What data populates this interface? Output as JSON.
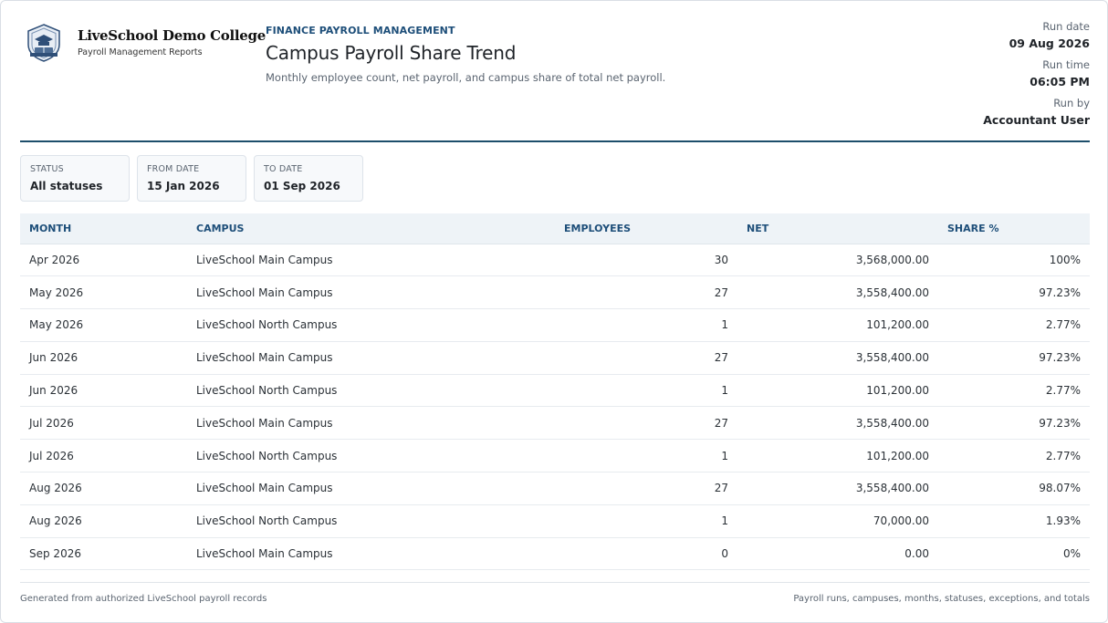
{
  "brand": {
    "name": "LiveSchool Demo College",
    "subtitle": "Payroll Management Reports",
    "logo_icon": "college-crest-icon"
  },
  "report": {
    "eyebrow": "FINANCE PAYROLL MANAGEMENT",
    "title": "Campus Payroll Share Trend",
    "subtitle": "Monthly employee count, net payroll, and campus share of total net payroll."
  },
  "meta": [
    {
      "label": "Run date",
      "value": "09 Aug 2026"
    },
    {
      "label": "Run time",
      "value": "06:05 PM"
    },
    {
      "label": "Run by",
      "value": "Accountant User"
    }
  ],
  "filters": [
    {
      "label": "STATUS",
      "value": "All statuses"
    },
    {
      "label": "FROM DATE",
      "value": "15 Jan 2026"
    },
    {
      "label": "TO DATE",
      "value": "01 Sep 2026"
    }
  ],
  "table": {
    "columns": [
      "MONTH",
      "CAMPUS",
      "EMPLOYEES",
      "NET",
      "SHARE %"
    ],
    "rows": [
      [
        "Apr 2026",
        "LiveSchool Main Campus",
        "30",
        "3,568,000.00",
        "100%"
      ],
      [
        "May 2026",
        "LiveSchool Main Campus",
        "27",
        "3,558,400.00",
        "97.23%"
      ],
      [
        "May 2026",
        "LiveSchool North Campus",
        "1",
        "101,200.00",
        "2.77%"
      ],
      [
        "Jun 2026",
        "LiveSchool Main Campus",
        "27",
        "3,558,400.00",
        "97.23%"
      ],
      [
        "Jun 2026",
        "LiveSchool North Campus",
        "1",
        "101,200.00",
        "2.77%"
      ],
      [
        "Jul 2026",
        "LiveSchool Main Campus",
        "27",
        "3,558,400.00",
        "97.23%"
      ],
      [
        "Jul 2026",
        "LiveSchool North Campus",
        "1",
        "101,200.00",
        "2.77%"
      ],
      [
        "Aug 2026",
        "LiveSchool Main Campus",
        "27",
        "3,558,400.00",
        "98.07%"
      ],
      [
        "Aug 2026",
        "LiveSchool North Campus",
        "1",
        "70,000.00",
        "1.93%"
      ],
      [
        "Sep 2026",
        "LiveSchool Main Campus",
        "0",
        "0.00",
        "0%"
      ]
    ]
  },
  "footer": {
    "left": "Generated from authorized LiveSchool payroll records",
    "right": "Payroll runs, campuses, months, statuses, exceptions, and totals"
  },
  "colors": {
    "accent": "#1d4e79",
    "rule": "#1d4e6b",
    "header_bg": "#eef3f7"
  }
}
